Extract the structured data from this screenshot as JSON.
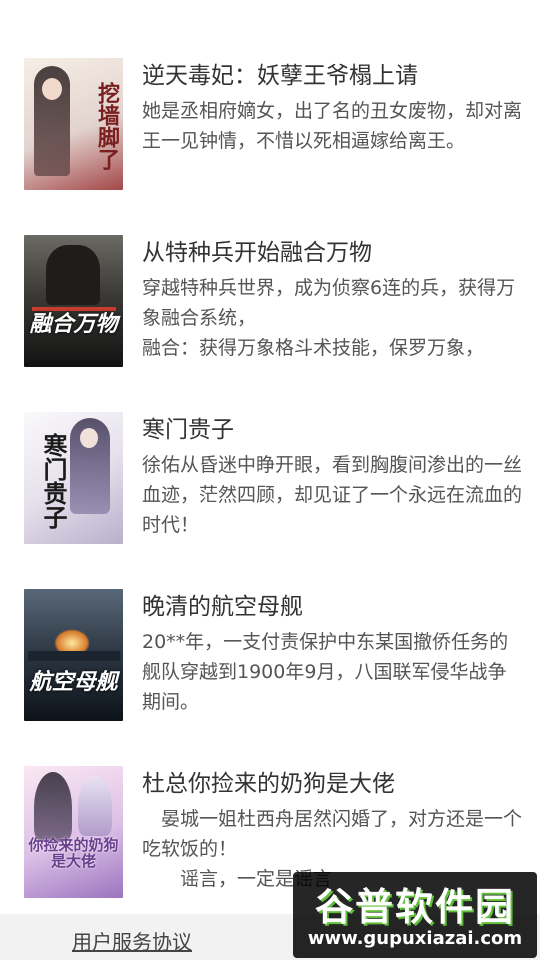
{
  "books": [
    {
      "title": "逆天毒妃：妖孽王爷榻上请",
      "description": "她是丞相府嫡女，出了名的丑女废物，却对离王一见钟情，不惜以死相逼嫁给离王。",
      "cover_text": "挖墙脚了",
      "cover_colors": [
        "#f4ede4",
        "#d8c7c0",
        "#8d2b2b"
      ]
    },
    {
      "title": "从特种兵开始融合万物",
      "description": "穿越特种兵世界，成为侦察6连的兵，获得万象融合系统，\n融合：获得万象格斗术技能，保罗万象，",
      "cover_text": "融合万物",
      "cover_colors": [
        "#3a3a3a",
        "#1a1a1a",
        "#c83b2e"
      ]
    },
    {
      "title": "寒门贵子",
      "description": "徐佑从昏迷中睁开眼，看到胸腹间渗出的一丝血迹，茫然四顾，却见证了一个永远在流血的时代！",
      "cover_text": "寒门贵子",
      "cover_colors": [
        "#f3f1f4",
        "#c7c1d6",
        "#5a4b7a"
      ]
    },
    {
      "title": "晚清的航空母舰",
      "description": "20**年，一支付责保护中东某国撤侨任务的舰队穿越到1900年9月，八国联军侵华战争期间。",
      "cover_text": "航空母舰",
      "cover_colors": [
        "#2e3a48",
        "#0f1720",
        "#d77a2a"
      ]
    },
    {
      "title": "杜总你捡来的奶狗是大佬",
      "description": "　晏城一姐杜西舟居然闪婚了，对方还是一个吃软饭的！\n　　谣言，一定是谣言",
      "cover_text": "你捡来的奶狗是大佬",
      "cover_colors": [
        "#f3d8ec",
        "#c8a6de",
        "#6b3e8e"
      ]
    }
  ],
  "footer": {
    "service_link": "用户服务协议"
  },
  "watermark": {
    "logo": "谷普软件园",
    "url": "www.gupuxiazai.com"
  }
}
